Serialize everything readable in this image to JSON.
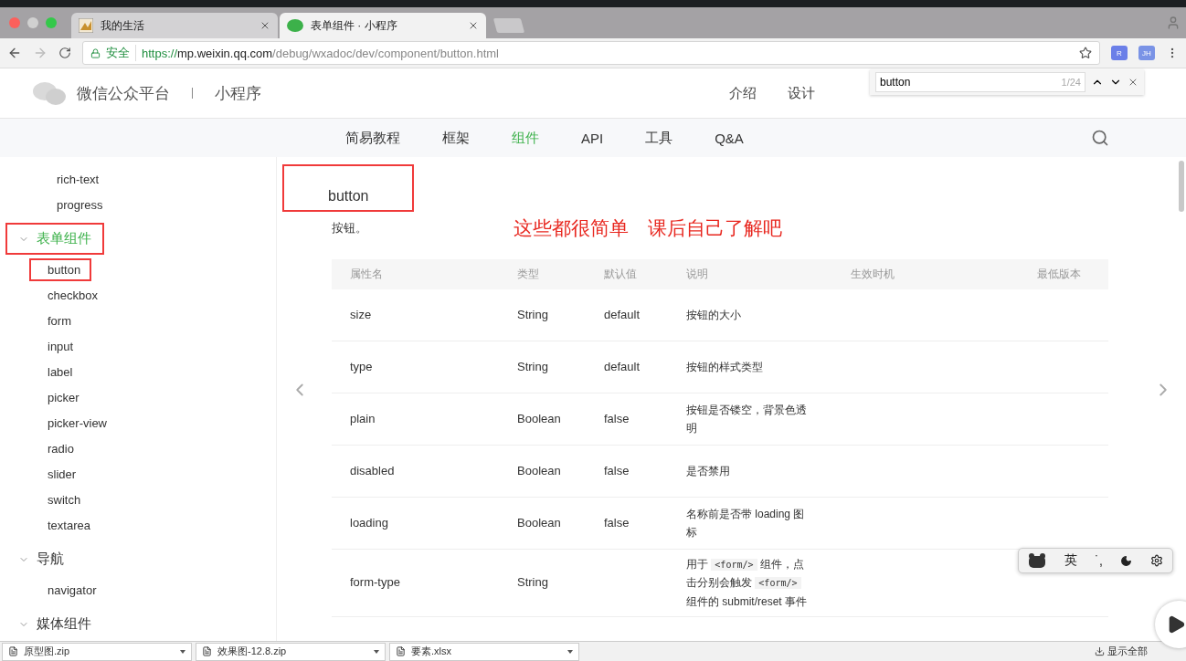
{
  "browser": {
    "tabs": [
      {
        "title": "我的生活",
        "selected": false,
        "kind": "picture"
      },
      {
        "title": "表单组件 · 小程序",
        "selected": true,
        "kind": "chat"
      }
    ],
    "security": "安全",
    "url": {
      "scheme": "https://",
      "host": "mp.weixin.qq.com",
      "path": "/debug/wxadoc/dev/component/button.html"
    },
    "extensions": [
      {
        "label": "R",
        "color": "#6b7fe8"
      },
      {
        "label": "JH",
        "color": "#7a93e6"
      }
    ]
  },
  "find_bar": {
    "value": "button",
    "count": "1/24"
  },
  "header": {
    "brand": "微信公众平台",
    "product": "小程序",
    "nav": [
      {
        "label": "介绍"
      },
      {
        "label": "设计"
      }
    ]
  },
  "subnav": [
    {
      "label": "简易教程",
      "selected": false
    },
    {
      "label": "框架",
      "selected": false
    },
    {
      "label": "组件",
      "selected": true
    },
    {
      "label": "API",
      "selected": false
    },
    {
      "label": "工具",
      "selected": false
    },
    {
      "label": "Q&A",
      "selected": false
    }
  ],
  "sidebar": [
    {
      "label": "rich-text",
      "kind": "item",
      "selected": false,
      "highlighted": false
    },
    {
      "label": "progress",
      "kind": "item",
      "selected": false,
      "highlighted": false
    },
    {
      "label": "表单组件",
      "kind": "group",
      "expanded": true,
      "selected": true,
      "highlighted": true,
      "children": [
        {
          "label": "button",
          "kind": "item",
          "selected": false,
          "highlighted": true
        },
        {
          "label": "checkbox",
          "kind": "item",
          "selected": false,
          "highlighted": false
        },
        {
          "label": "form",
          "kind": "item",
          "selected": false,
          "highlighted": false
        },
        {
          "label": "input",
          "kind": "item",
          "selected": false,
          "highlighted": false
        },
        {
          "label": "label",
          "kind": "item",
          "selected": false,
          "highlighted": false
        },
        {
          "label": "picker",
          "kind": "item",
          "selected": false,
          "highlighted": false
        },
        {
          "label": "picker-view",
          "kind": "item",
          "selected": false,
          "highlighted": false
        },
        {
          "label": "radio",
          "kind": "item",
          "selected": false,
          "highlighted": false
        },
        {
          "label": "slider",
          "kind": "item",
          "selected": false,
          "highlighted": false
        },
        {
          "label": "switch",
          "kind": "item",
          "selected": false,
          "highlighted": false
        },
        {
          "label": "textarea",
          "kind": "item",
          "selected": false,
          "highlighted": false
        }
      ]
    },
    {
      "label": "导航",
      "kind": "group",
      "expanded": true,
      "selected": false,
      "highlighted": false,
      "children": [
        {
          "label": "navigator",
          "kind": "item",
          "selected": false,
          "highlighted": false
        }
      ]
    },
    {
      "label": "媒体组件",
      "kind": "group",
      "expanded": true,
      "selected": false,
      "highlighted": false
    }
  ],
  "content": {
    "title": "button",
    "title_highlighted": true,
    "intro": "按钮。",
    "annotation": "这些都很简单　课后自己了解吧",
    "table": {
      "columns": [
        "属性名",
        "类型",
        "默认值",
        "说明",
        "生效时机",
        "最低版本"
      ],
      "rows": [
        {
          "name": "size",
          "type": "String",
          "default": "default",
          "description": [
            {
              "kind": "text",
              "text": "按钮的大小"
            }
          ]
        },
        {
          "name": "type",
          "type": "String",
          "default": "default",
          "description": [
            {
              "kind": "text",
              "text": "按钮的样式类型"
            }
          ]
        },
        {
          "name": "plain",
          "type": "Boolean",
          "default": "false",
          "description": [
            {
              "kind": "text",
              "text": "按钮是否镂空，背景色透明"
            }
          ]
        },
        {
          "name": "disabled",
          "type": "Boolean",
          "default": "false",
          "description": [
            {
              "kind": "text",
              "text": "是否禁用"
            }
          ]
        },
        {
          "name": "loading",
          "type": "Boolean",
          "default": "false",
          "description": [
            {
              "kind": "text",
              "text": "名称前是否带 loading 图标"
            }
          ]
        },
        {
          "name": "form-type",
          "type": "String",
          "default": "",
          "description": [
            {
              "kind": "text",
              "text": "用于 "
            },
            {
              "kind": "code",
              "text": "<form/>"
            },
            {
              "kind": "text",
              "text": " 组件，点击分别会触发 "
            },
            {
              "kind": "code",
              "text": "<form/>"
            },
            {
              "kind": "text",
              "text": " 组件的 submit/reset 事件"
            }
          ]
        }
      ]
    }
  },
  "ime_bar": {
    "language": "英",
    "punctuation": "˙,"
  },
  "downloads": [
    {
      "name": "原型图.zip"
    },
    {
      "name": "效果图-12.8.zip"
    },
    {
      "name": "要素.xlsx"
    }
  ],
  "download_action": "显示全部"
}
